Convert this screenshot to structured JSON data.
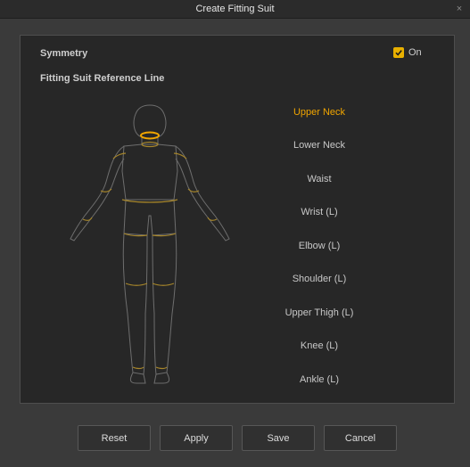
{
  "window": {
    "title": "Create Fitting Suit",
    "close_glyph": "×"
  },
  "symmetry": {
    "label": "Symmetry",
    "checkbox_label": "On",
    "checked": true
  },
  "reference": {
    "label": "Fitting Suit Reference Line",
    "lines": [
      {
        "label": "Upper Neck",
        "active": true
      },
      {
        "label": "Lower Neck",
        "active": false
      },
      {
        "label": "Waist",
        "active": false
      },
      {
        "label": "Wrist (L)",
        "active": false
      },
      {
        "label": "Elbow (L)",
        "active": false
      },
      {
        "label": "Shoulder (L)",
        "active": false
      },
      {
        "label": "Upper Thigh (L)",
        "active": false
      },
      {
        "label": "Knee (L)",
        "active": false
      },
      {
        "label": "Ankle (L)",
        "active": false
      }
    ]
  },
  "buttons": {
    "reset": "Reset",
    "apply": "Apply",
    "save": "Save",
    "cancel": "Cancel"
  },
  "colors": {
    "accent": "#f0a500",
    "checkbox": "#e8b000",
    "body_outline": "#7a7a7a",
    "reference_line": "#a7862a"
  },
  "icons": {
    "checkbox": "check-icon",
    "close": "close-icon"
  }
}
